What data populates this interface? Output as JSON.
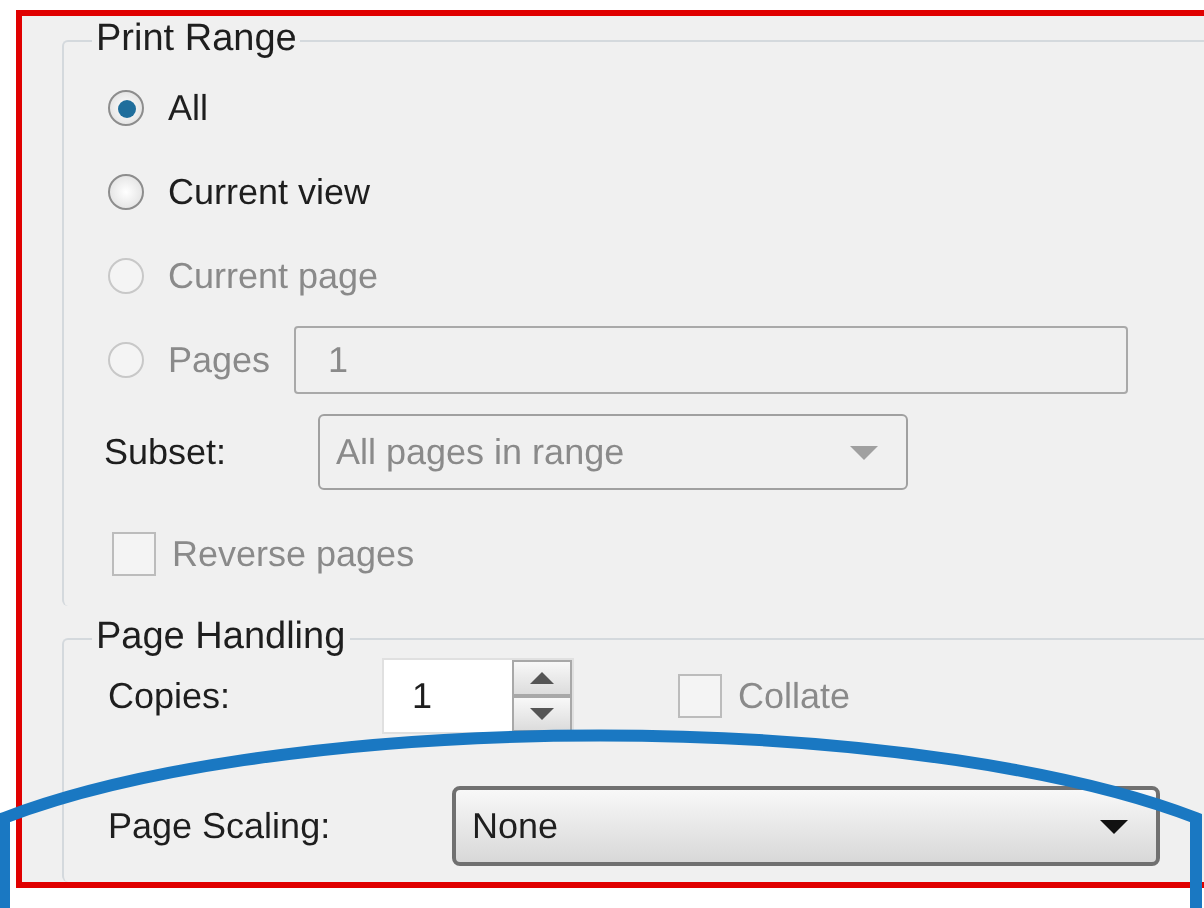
{
  "print_range": {
    "title": "Print Range",
    "options": [
      {
        "label": "All",
        "selected": true,
        "disabled": false
      },
      {
        "label": "Current view",
        "selected": false,
        "disabled": false
      },
      {
        "label": "Current page",
        "selected": false,
        "disabled": true
      },
      {
        "label": "Pages",
        "selected": false,
        "disabled": true,
        "field_value": "1"
      }
    ],
    "subset": {
      "label": "Subset:",
      "value": "All pages in range",
      "disabled": true
    },
    "reverse_pages": {
      "label": "Reverse pages",
      "checked": false,
      "disabled": true
    }
  },
  "page_handling": {
    "title": "Page Handling",
    "copies": {
      "label": "Copies:",
      "value": "1"
    },
    "collate": {
      "label": "Collate",
      "checked": false,
      "disabled": true
    },
    "page_scaling": {
      "label": "Page Scaling:",
      "value": "None"
    }
  },
  "annotation": {
    "kind": "ellipse"
  }
}
